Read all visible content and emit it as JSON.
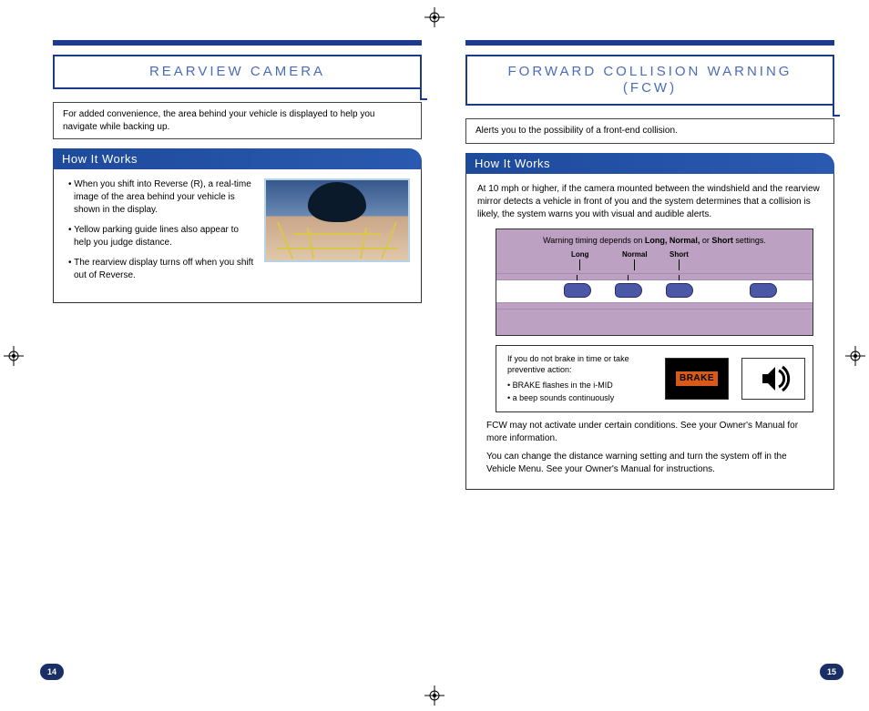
{
  "left": {
    "title": "REARVIEW CAMERA",
    "intro": "For added convenience, the area behind your vehicle is displayed to help you navigate while backing up.",
    "section_header": "How It Works",
    "bullets": [
      "When you shift into Reverse (R), a real-time image of the area behind your vehicle is shown in the display.",
      "Yellow parking guide lines also appear to help you judge distance.",
      "The rearview display turns off when you shift out of Reverse."
    ],
    "page_number": "14"
  },
  "right": {
    "title": "FORWARD COLLISION WARNING (FCW)",
    "intro": "Alerts you to the possibility of a front-end collision.",
    "section_header": "How It Works",
    "desc": "At 10 mph or higher, if the camera mounted between the windshield and the rearview mirror detects a vehicle in front of you and the system determines that a collision is likely, the system warns you with visual and audible alerts.",
    "diagram_caption_pre": "Warning timing depends on ",
    "diagram_caption_bold": "Long, Normal,",
    "diagram_caption_mid": " or ",
    "diagram_caption_bold2": "Short",
    "diagram_caption_post": " settings.",
    "labels": {
      "long": "Long",
      "normal": "Normal",
      "short": "Short"
    },
    "alert_intro": "If you do not brake in time or take preventive action:",
    "alert_bullets": [
      "BRAKE flashes in the i-MID",
      "a beep sounds continuously"
    ],
    "brake_label": "BRAKE",
    "note1": "FCW may not activate under certain conditions. See your Owner's Manual for more information.",
    "note2": "You can change the distance warning setting and turn the system off in the Vehicle Menu. See your Owner's Manual for instructions.",
    "page_number": "15"
  }
}
